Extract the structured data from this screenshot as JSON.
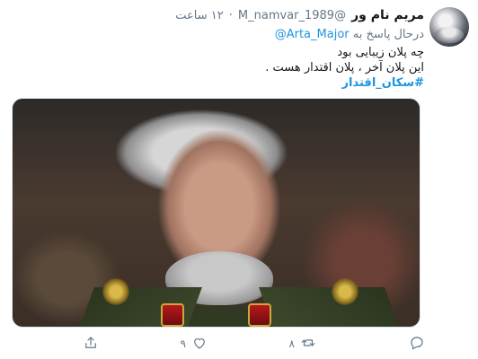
{
  "tweet": {
    "author_name": "مریم نام ور",
    "handle": "@M_namvar_1989",
    "separator": "·",
    "time": "۱۲ ساعت",
    "reply_prefix": "درحال پاسخ به",
    "reply_mention": "@Arta_Major",
    "lines": [
      "چه پلان زیبایی بود",
      "این پلان آخر ، پلان اقتدار هست ."
    ],
    "hashtag": "#سکان_اقتدار",
    "media_alt": "تصویر"
  },
  "actions": {
    "reply_count": "",
    "retweet_count": "۸",
    "like_count": "۹",
    "share_count": ""
  },
  "colors": {
    "accent": "#1b95e0",
    "muted": "#657786",
    "text": "#14171a"
  },
  "icons": [
    "reply-icon",
    "retweet-icon",
    "like-icon",
    "share-icon"
  ]
}
